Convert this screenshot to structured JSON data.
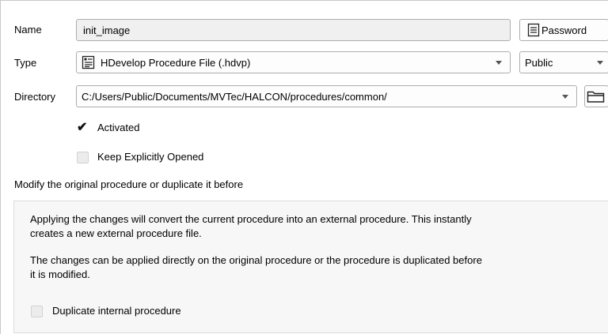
{
  "name": {
    "label": "Name",
    "value": "init_image"
  },
  "password_button": {
    "label": "Password",
    "icon": "document-lines-icon"
  },
  "type": {
    "label": "Type",
    "value": "HDevelop Procedure File (.hdvp)",
    "icon": "procedure-file-icon"
  },
  "visibility": {
    "value": "Public"
  },
  "directory": {
    "label": "Directory",
    "value": "C:/Users/Public/Documents/MVTec/HALCON/procedures/common/",
    "browse_icon": "folder-icon"
  },
  "activated": {
    "label": "Activated",
    "checked": true
  },
  "keep_opened": {
    "label": "Keep Explicitly Opened",
    "checked": false
  },
  "modify_section": {
    "title": "Modify the original procedure or duplicate it before",
    "info1_line1": "Applying the changes will convert the current procedure into an external procedure. This instantly",
    "info1_line2": "creates a new external procedure file.",
    "info2_line1": "The changes can be applied directly on the original procedure or the procedure is duplicated before",
    "info2_line2": "it is modified.",
    "duplicate_label": "Duplicate internal procedure",
    "duplicate_checked": false
  }
}
